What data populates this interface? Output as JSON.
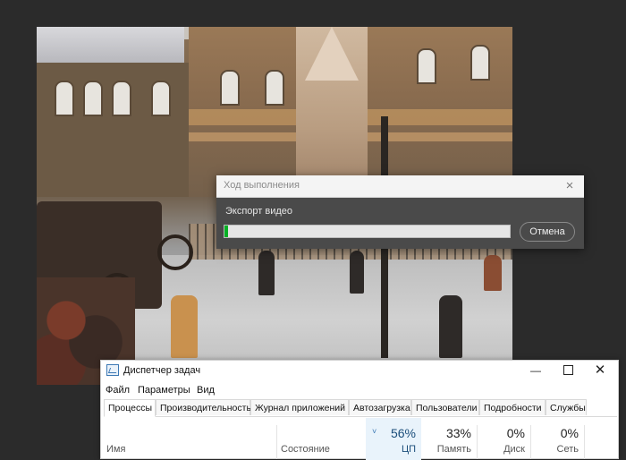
{
  "progress_dialog": {
    "title": "Ход выполнения",
    "label": "Экспорт видео",
    "progress_fraction": 0.01,
    "cancel_label": "Отмена",
    "close_icon": "×"
  },
  "task_manager": {
    "title": "Диспетчер задач",
    "window_buttons": {
      "minimize": "—",
      "close": "✕"
    },
    "menu": [
      "Файл",
      "Параметры",
      "Вид"
    ],
    "tabs": [
      "Процессы",
      "Производительность",
      "Журнал приложений",
      "Автозагрузка",
      "Пользователи",
      "Подробности",
      "Службы"
    ],
    "columns": {
      "name": "Имя",
      "status": "Состояние",
      "cpu": {
        "pct": "56%",
        "label": "ЦП"
      },
      "memory": {
        "pct": "33%",
        "label": "Память"
      },
      "disk": {
        "pct": "0%",
        "label": "Диск"
      },
      "network": {
        "pct": "0%",
        "label": "Сеть"
      }
    },
    "sort_icon": "˅"
  },
  "colors": {
    "progress_fill": "#06b025",
    "cpu_highlight": "#e9f3fb",
    "desktop": "#2b2b2b"
  }
}
